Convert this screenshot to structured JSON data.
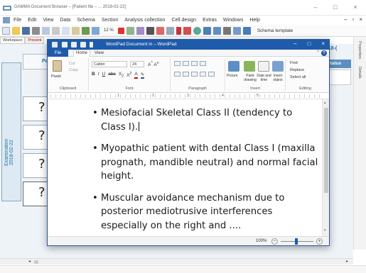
{
  "app": {
    "title": "GAMMA Document Browser – [Patient file – ... 2018-02-22]",
    "menu": [
      "File",
      "Edit",
      "View",
      "Data",
      "Schema",
      "Section",
      "Analysis collection",
      "Cell design",
      "Extras",
      "Windows",
      "Help"
    ],
    "toolbar": {
      "zoom": "12 %",
      "template_label": "Schema template"
    },
    "tabs": [
      "Workspace",
      "Present"
    ],
    "side_labels": [
      "Properties",
      "Details"
    ],
    "left_tab": {
      "line1": "Examination",
      "line2": "2018-02-22"
    },
    "question_mark": "?",
    "bg_left_partial": "Pa",
    "bg_year": "2018-(",
    "bg_status": "nstatus"
  },
  "wordpad": {
    "title": "WordPad Document in – WordPad",
    "tabs": {
      "file": "File",
      "home": "Home",
      "view": "View"
    },
    "ribbon": {
      "clipboard": {
        "label": "Clipboard",
        "paste": "Paste",
        "cut": "Cut",
        "copy": "Copy"
      },
      "font": {
        "label": "Font",
        "family": "Calibri",
        "size": "24"
      },
      "paragraph": {
        "label": "Paragraph"
      },
      "insert": {
        "label": "Insert",
        "picture": "Picture",
        "paint": "Paint drawing",
        "datetime": "Date and time",
        "object": "Insert object"
      },
      "editing": {
        "label": "Editing",
        "find": "Find",
        "replace": "Replace",
        "select_all": "Select all"
      }
    },
    "ruler_numbers": [
      "1",
      "2",
      "3",
      "4",
      "5"
    ],
    "document": {
      "bullets": [
        "Mesiofacial Skeletal Class II (tendency to Class I).",
        "Myopathic patient with dental Class I (maxilla prognath, mandible neutral) and normal facial height.",
        "Muscular avoidance mechanism due to posterior mediotrusive interferences especially on the right and ...."
      ]
    },
    "zoom_percent": "100%",
    "colors": {
      "accent": "#1f5bab"
    }
  }
}
